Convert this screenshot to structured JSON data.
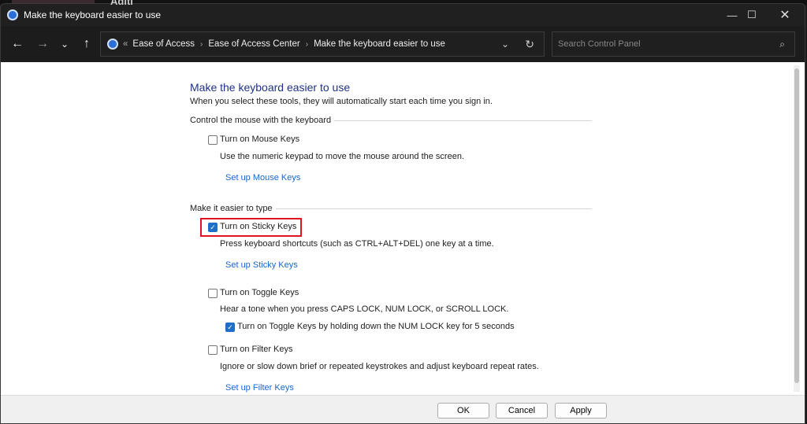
{
  "background": {
    "text": "Aditi"
  },
  "window": {
    "title": "Make the keyboard easier to use"
  },
  "nav": {
    "back": "←",
    "forward": "→",
    "recent": "⌄",
    "up": "↑"
  },
  "address": {
    "overflow": "«",
    "crumbs": [
      "Ease of Access",
      "Ease of Access Center",
      "Make the keyboard easier to use"
    ],
    "sep": "›"
  },
  "search": {
    "placeholder": "Search Control Panel"
  },
  "page": {
    "title": "Make the keyboard easier to use",
    "subtitle": "When you select these tools, they will automatically start each time you sign in.",
    "groups": [
      {
        "label": "Control the mouse with the keyboard"
      },
      {
        "label": "Make it easier to type"
      }
    ],
    "mouse_keys": {
      "label": "Turn on Mouse Keys",
      "checked": false,
      "desc": "Use the numeric keypad to move the mouse around the screen.",
      "link": "Set up Mouse Keys"
    },
    "sticky_keys": {
      "label": "Turn on Sticky Keys",
      "checked": true,
      "desc": "Press keyboard shortcuts (such as CTRL+ALT+DEL) one key at a time.",
      "link": "Set up Sticky Keys",
      "highlight_color": "#e0141e"
    },
    "toggle_keys": {
      "label": "Turn on Toggle Keys",
      "checked": false,
      "desc": "Hear a tone when you press CAPS LOCK, NUM LOCK, or SCROLL LOCK.",
      "sub_label": "Turn on Toggle Keys by holding down the NUM LOCK key for 5 seconds",
      "sub_checked": true
    },
    "filter_keys": {
      "label": "Turn on Filter Keys",
      "checked": false,
      "desc": "Ignore or slow down brief or repeated keystrokes and adjust keyboard repeat rates.",
      "link": "Set up Filter Keys"
    }
  },
  "footer": {
    "ok": "OK",
    "cancel": "Cancel",
    "apply": "Apply"
  },
  "colors": {
    "link": "#1a66c9",
    "title": "#1e3287",
    "check": "#1f6fc9"
  }
}
